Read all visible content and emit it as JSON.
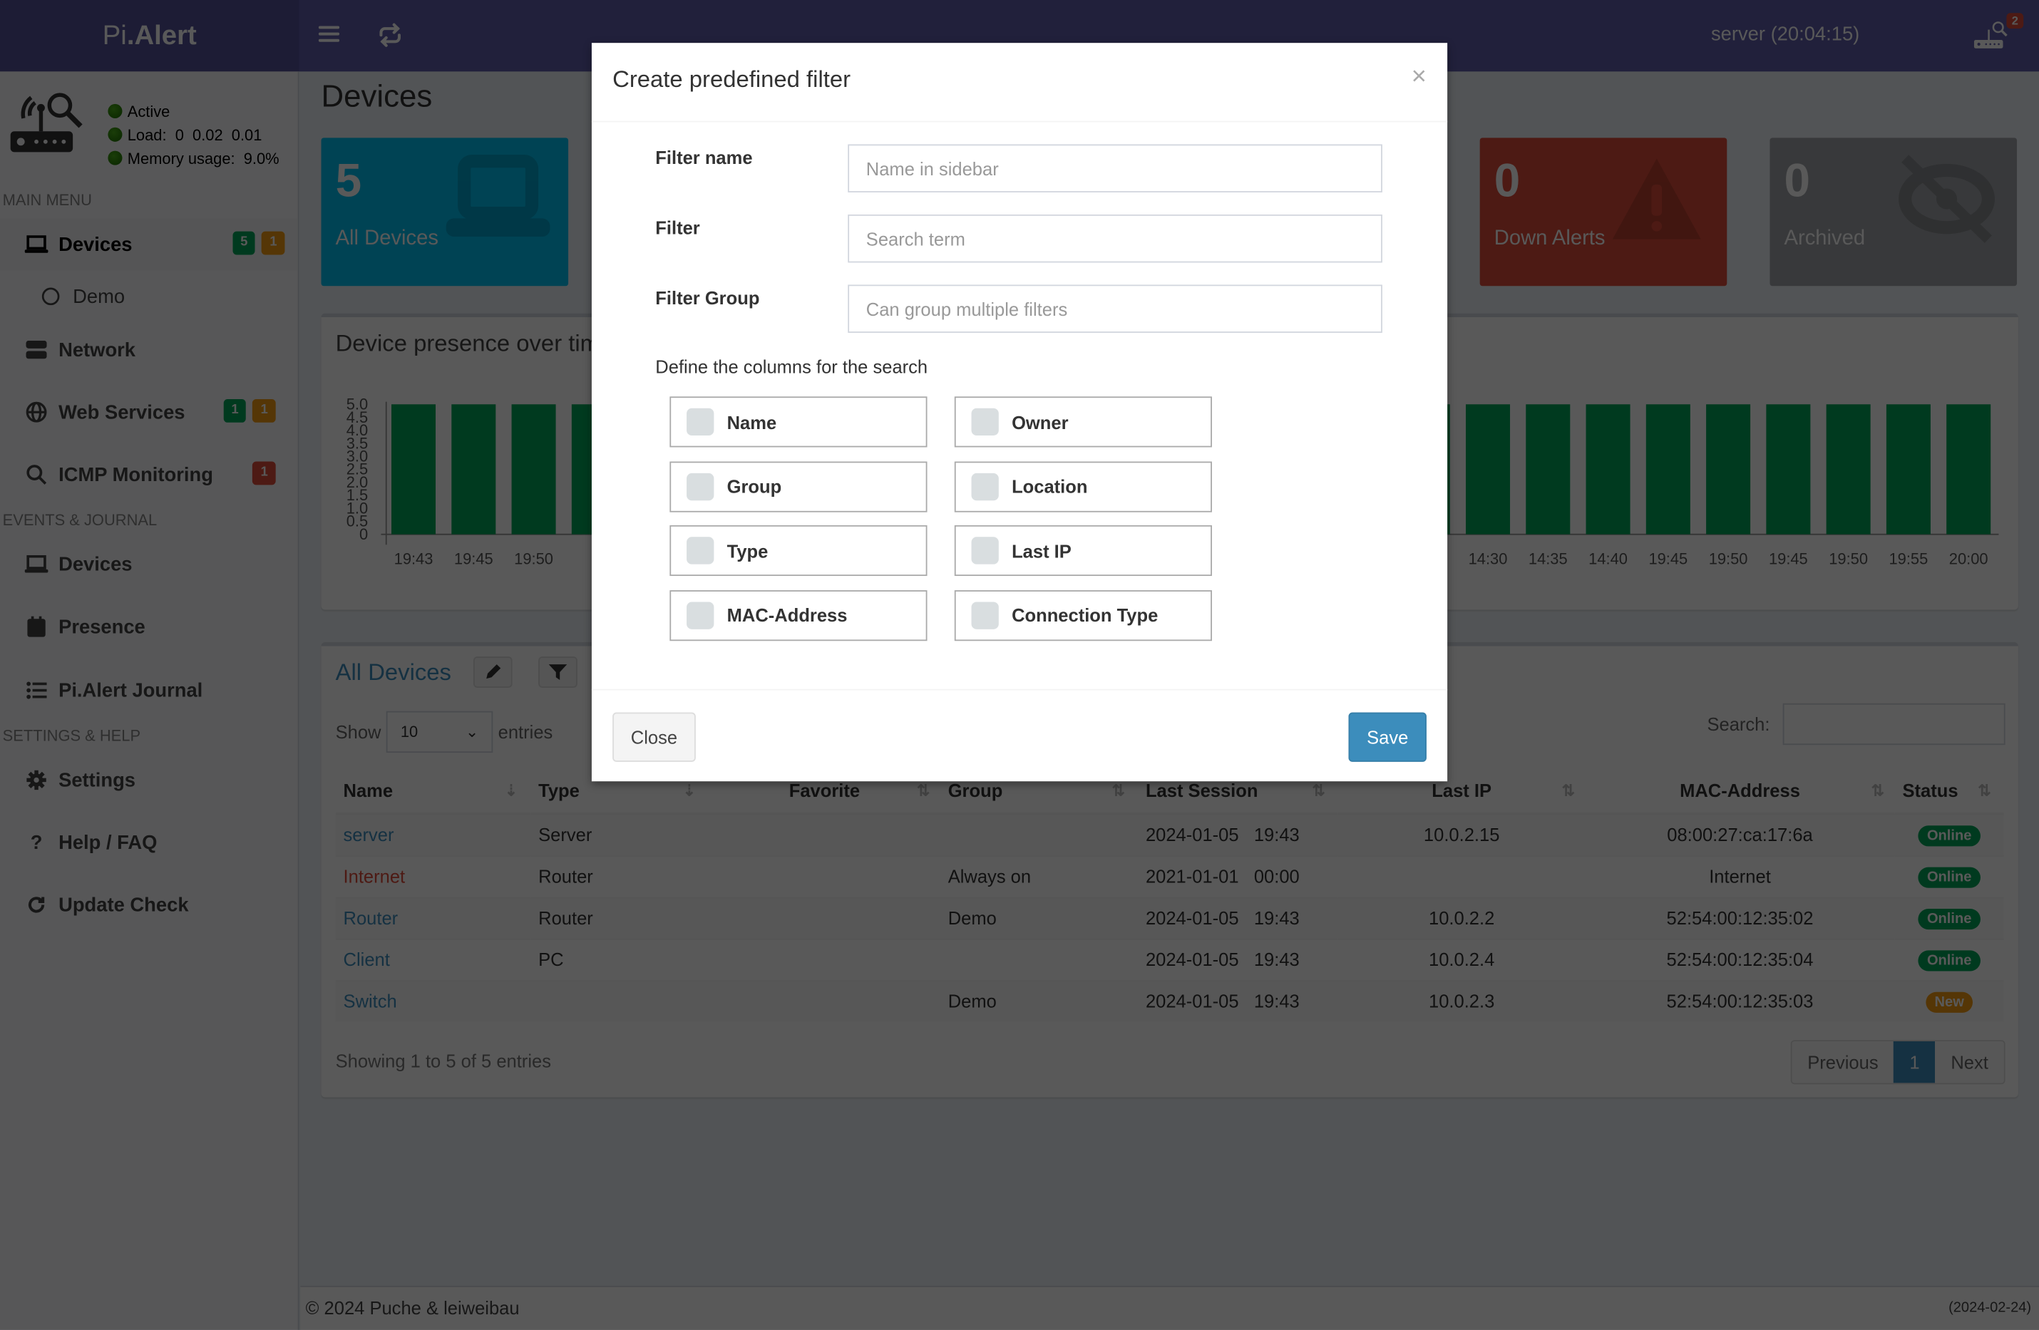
{
  "app": {
    "logo_light": "Pi",
    "logo_bold": ".Alert",
    "server_clock": "server (20:04:15)",
    "notification_count": "2"
  },
  "sidebar": {
    "status": {
      "active": "Active",
      "load": "Load:  0  0.02  0.01",
      "memory": "Memory usage:  9.0%"
    },
    "sections": {
      "main_menu": "MAIN MENU",
      "events_journal": "EVENTS & JOURNAL",
      "settings_help": "SETTINGS & HELP"
    },
    "items": [
      {
        "label": "Devices",
        "icon": "laptop-icon",
        "badges": [
          "5",
          "1"
        ]
      },
      {
        "label": "Demo",
        "icon": "circle-icon"
      },
      {
        "label": "Network",
        "icon": "server-icon"
      },
      {
        "label": "Web Services",
        "icon": "globe-icon",
        "badges": [
          "1",
          "1"
        ]
      },
      {
        "label": "ICMP Monitoring",
        "icon": "search-icon",
        "badges": [
          "1"
        ]
      },
      {
        "label": "Devices",
        "icon": "laptop-icon"
      },
      {
        "label": "Presence",
        "icon": "calendar-icon"
      },
      {
        "label": "Pi.Alert Journal",
        "icon": "list-icon"
      },
      {
        "label": "Settings",
        "icon": "gear-icon"
      },
      {
        "label": "Help / FAQ",
        "icon": "question-icon"
      },
      {
        "label": "Update Check",
        "icon": "refresh-icon"
      }
    ]
  },
  "main": {
    "page_title": "Devices",
    "info_boxes": [
      {
        "value": "5",
        "label": "All Devices",
        "color": "#00c0ef",
        "icon": "laptop-icon"
      },
      {
        "value": "0",
        "label": "Down Alerts",
        "color": "#dd4b39",
        "icon": "warning-icon"
      },
      {
        "value": "0",
        "label": "Archived",
        "color": "#a0a4a8",
        "icon": "eye-slash-icon"
      }
    ],
    "presence_chart_title": "Device presence over tim",
    "devices_table": {
      "title": "All Devices",
      "show_label": "Show",
      "entries_label": "entries",
      "page_size": "10",
      "search_label": "Search:",
      "search_value": "",
      "columns": [
        "Name",
        "Type",
        "Favorite",
        "Group",
        "Last Session",
        "Last IP",
        "MAC-Address",
        "Status"
      ],
      "rows": [
        {
          "name": "server",
          "type": "Server",
          "favorite": "",
          "group": "",
          "last_session": "2024-01-05   19:43",
          "last_ip": "10.0.2.15",
          "mac": "08:00:27:ca:17:6a",
          "status": "Online"
        },
        {
          "name": "Internet",
          "type": "Router",
          "favorite": "",
          "group": "Always on",
          "last_session": "2021-01-01   00:00",
          "last_ip": "",
          "mac": "Internet",
          "status": "Online"
        },
        {
          "name": "Router",
          "type": "Router",
          "favorite": "",
          "group": "Demo",
          "last_session": "2024-01-05   19:43",
          "last_ip": "10.0.2.2",
          "mac": "52:54:00:12:35:02",
          "status": "Online"
        },
        {
          "name": "Client",
          "type": "PC",
          "favorite": "",
          "group": "",
          "last_session": "2024-01-05   19:43",
          "last_ip": "10.0.2.4",
          "mac": "52:54:00:12:35:04",
          "status": "Online"
        },
        {
          "name": "Switch",
          "type": "",
          "favorite": "",
          "group": "Demo",
          "last_session": "2024-01-05   19:43",
          "last_ip": "10.0.2.3",
          "mac": "52:54:00:12:35:03",
          "status": "New"
        }
      ],
      "paging_info": "Showing 1 to 5 of 5 entries",
      "pager": {
        "previous": "Previous",
        "current": "1",
        "next": "Next"
      }
    }
  },
  "footer": {
    "copyright": "© 2024 Puche & leiweibau",
    "version": "(2024-02-24)"
  },
  "modal": {
    "title": "Create predefined filter",
    "close_symbol": "×",
    "fields": [
      {
        "label": "Filter name",
        "placeholder": "Name in sidebar",
        "value": ""
      },
      {
        "label": "Filter",
        "placeholder": "Search term",
        "value": ""
      },
      {
        "label": "Filter Group",
        "placeholder": "Can group multiple filters",
        "value": ""
      }
    ],
    "columns_label": "Define the columns for the search",
    "column_options": [
      {
        "label": "Name",
        "checked": false
      },
      {
        "label": "Owner",
        "checked": false
      },
      {
        "label": "Group",
        "checked": false
      },
      {
        "label": "Location",
        "checked": false
      },
      {
        "label": "Type",
        "checked": false
      },
      {
        "label": "Last IP",
        "checked": false
      },
      {
        "label": "MAC-Address",
        "checked": false
      },
      {
        "label": "Connection Type",
        "checked": false
      }
    ],
    "close_button": "Close",
    "save_button": "Save"
  },
  "chart_data": {
    "type": "bar",
    "title": "Device presence over time",
    "xlabel": "",
    "ylabel": "",
    "ylim": [
      0,
      5.0
    ],
    "yticks": [
      "0",
      "0.5",
      "1.0",
      "1.5",
      "2.0",
      "2.5",
      "3.0",
      "3.5",
      "4.0",
      "4.5",
      "5.0"
    ],
    "grid": false,
    "visible_left_categories": [
      "19:43",
      "19:45",
      "19:50"
    ],
    "visible_right_categories": [
      "14:30",
      "14:35",
      "14:40",
      "19:45",
      "19:50",
      "19:45",
      "19:50",
      "19:55",
      "20:00"
    ],
    "series": [
      {
        "name": "Online",
        "color": "#00a65a",
        "left_values": [
          5,
          5,
          5
        ],
        "right_values": [
          5,
          5,
          5,
          5,
          5,
          5,
          5,
          5,
          5
        ]
      }
    ]
  }
}
